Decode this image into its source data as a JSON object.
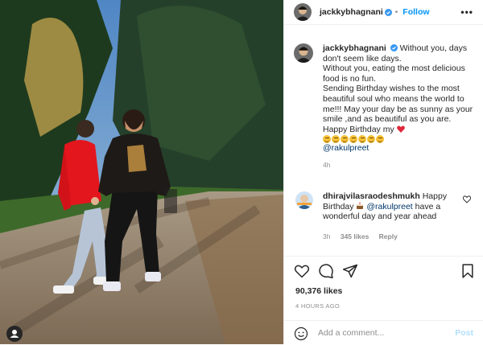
{
  "header": {
    "username": "jackkybhagnani",
    "separator": "•",
    "follow_label": "Follow",
    "more_label": "•••"
  },
  "caption": {
    "username": "jackkybhagnani",
    "lines": [
      "Without you, days don't seem like days.",
      "Without you, eating the most delicious food is no fun.",
      "Sending Birthday wishes to the most beautiful soul who means the world to me!!! May your day be as sunny as your smile ,and as beautiful as you are.",
      "Happy Birthday my"
    ],
    "mention": "@rakulpreet",
    "time": "4h",
    "emoji_count": 7
  },
  "comment": {
    "username": "dhirajvilasraodeshmukh",
    "text_before": "Happy Birthday",
    "mention": "@rakulpreet",
    "text_after": "have a wonderful day and year ahead",
    "time": "3h",
    "likes": "345 likes",
    "reply": "Reply"
  },
  "likes_count": "90,376 likes",
  "timestamp": "4 HOURS AGO",
  "add_comment": {
    "placeholder": "Add a comment...",
    "post_label": "Post"
  },
  "colors": {
    "accent": "#0095f6",
    "verified": "#3897f0",
    "heart": "#ed4956",
    "mention": "#00376b"
  }
}
